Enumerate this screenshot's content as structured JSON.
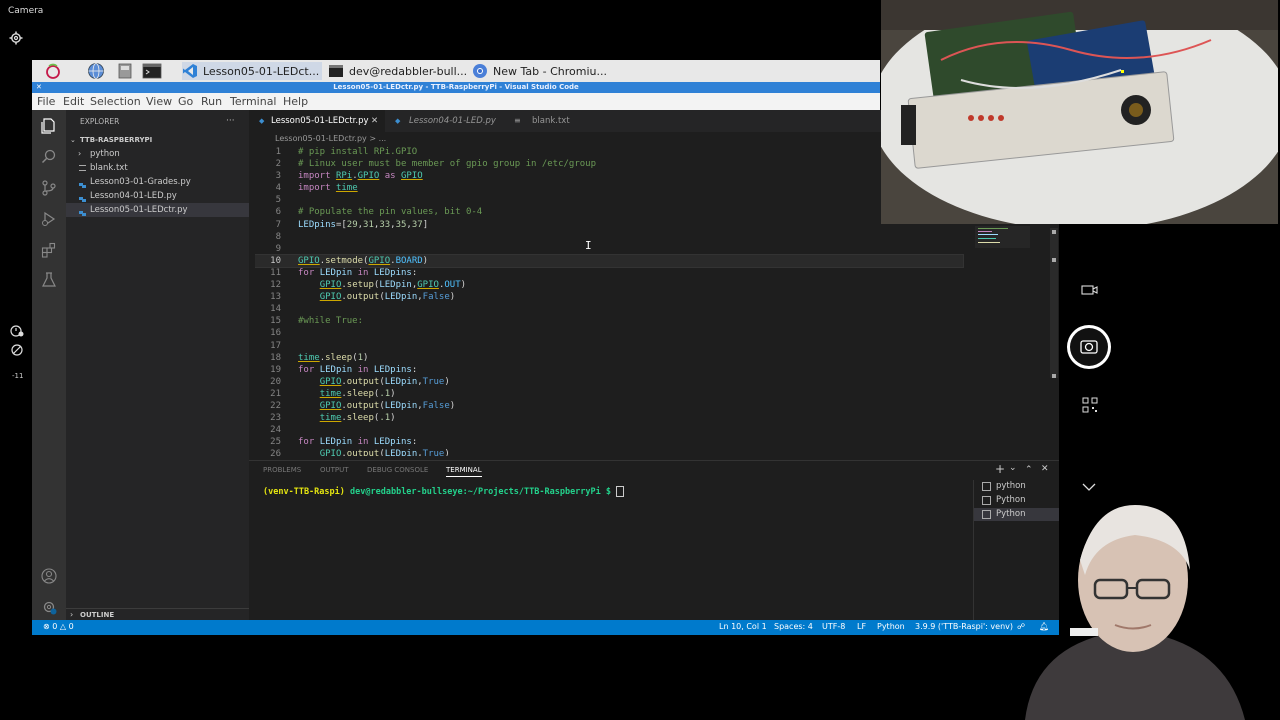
{
  "camera_app": {
    "title": "Camera",
    "left_icons": [
      "gear-icon",
      "timer-icon",
      "exposure-icon"
    ],
    "exposure_value": "-11"
  },
  "taskbar": {
    "tasks": [
      {
        "label": "Lesson05-01-LEDct...",
        "icon": "vscode-icon"
      },
      {
        "label": "dev@redabbler-bull...",
        "icon": "terminal-icon"
      },
      {
        "label": "New Tab - Chromiu...",
        "icon": "chromium-icon"
      }
    ]
  },
  "vscode": {
    "window_title": "Lesson05-01-LEDctr.py - TTB-RaspberryPi - Visual Studio Code",
    "menu": [
      "File",
      "Edit",
      "Selection",
      "View",
      "Go",
      "Run",
      "Terminal",
      "Help"
    ],
    "explorer": {
      "header": "EXPLORER",
      "more": "···",
      "root": "TTB-RASPBERRYPI",
      "items": [
        {
          "label": "python",
          "type": "folder"
        },
        {
          "label": "blank.txt",
          "type": "file"
        },
        {
          "label": "Lesson03-01-Grades.py",
          "type": "py"
        },
        {
          "label": "Lesson04-01-LED.py",
          "type": "py"
        },
        {
          "label": "Lesson05-01-LEDctr.py",
          "type": "py",
          "selected": true
        }
      ],
      "outline": "OUTLINE"
    },
    "tabs": [
      {
        "label": "Lesson05-01-LEDctr.py",
        "active": true,
        "close": "✕"
      },
      {
        "label": "Lesson04-01-LED.py",
        "active": false
      },
      {
        "label": "blank.txt",
        "active": false
      }
    ],
    "breadcrumb": "Lesson05-01-LEDctr.py > ...",
    "current_line": 10,
    "code": [
      {
        "n": "1",
        "tokens": [
          {
            "c": "cmt",
            "t": "# pip install RPi.GPIO"
          }
        ]
      },
      {
        "n": "2",
        "tokens": [
          {
            "c": "cmt",
            "t": "# Linux user must be member of gpio group in /etc/group"
          }
        ]
      },
      {
        "n": "3",
        "tokens": [
          {
            "c": "kw",
            "t": "import "
          },
          {
            "c": "mod",
            "t": "RPi"
          },
          {
            "c": "txt",
            "t": "."
          },
          {
            "c": "mod",
            "t": "GPIO"
          },
          {
            "c": "kw",
            "t": " as "
          },
          {
            "c": "mod",
            "t": "GPIO"
          }
        ]
      },
      {
        "n": "4",
        "tokens": [
          {
            "c": "kw",
            "t": "import "
          },
          {
            "c": "mod",
            "t": "time"
          }
        ]
      },
      {
        "n": "5",
        "tokens": []
      },
      {
        "n": "6",
        "tokens": [
          {
            "c": "cmt",
            "t": "# Populate the pin values, bit 0-4"
          }
        ]
      },
      {
        "n": "7",
        "tokens": [
          {
            "c": "var",
            "t": "LEDpins"
          },
          {
            "c": "txt",
            "t": "=["
          },
          {
            "c": "num",
            "t": "29"
          },
          {
            "c": "txt",
            "t": ","
          },
          {
            "c": "num",
            "t": "31"
          },
          {
            "c": "txt",
            "t": ","
          },
          {
            "c": "num",
            "t": "33"
          },
          {
            "c": "txt",
            "t": ","
          },
          {
            "c": "num",
            "t": "35"
          },
          {
            "c": "txt",
            "t": ","
          },
          {
            "c": "num",
            "t": "37"
          },
          {
            "c": "txt",
            "t": "]"
          }
        ]
      },
      {
        "n": "8",
        "tokens": []
      },
      {
        "n": "9",
        "tokens": []
      },
      {
        "n": "10",
        "tokens": [
          {
            "c": "mod",
            "t": "GPIO"
          },
          {
            "c": "txt",
            "t": "."
          },
          {
            "c": "fn",
            "t": "setmode"
          },
          {
            "c": "txt",
            "t": "("
          },
          {
            "c": "mod",
            "t": "GPIO"
          },
          {
            "c": "txt",
            "t": "."
          },
          {
            "c": "const",
            "t": "BOARD"
          },
          {
            "c": "txt",
            "t": ")"
          }
        ]
      },
      {
        "n": "11",
        "tokens": [
          {
            "c": "kw",
            "t": "for "
          },
          {
            "c": "var",
            "t": "LEDpin"
          },
          {
            "c": "kw",
            "t": " in "
          },
          {
            "c": "var",
            "t": "LEDpins"
          },
          {
            "c": "txt",
            "t": ":"
          }
        ]
      },
      {
        "n": "12",
        "tokens": [
          {
            "c": "txt",
            "t": "    "
          },
          {
            "c": "mod",
            "t": "GPIO"
          },
          {
            "c": "txt",
            "t": "."
          },
          {
            "c": "fn",
            "t": "setup"
          },
          {
            "c": "txt",
            "t": "("
          },
          {
            "c": "var",
            "t": "LEDpin"
          },
          {
            "c": "txt",
            "t": ","
          },
          {
            "c": "mod",
            "t": "GPIO"
          },
          {
            "c": "txt",
            "t": "."
          },
          {
            "c": "const",
            "t": "OUT"
          },
          {
            "c": "txt",
            "t": ")"
          }
        ]
      },
      {
        "n": "13",
        "tokens": [
          {
            "c": "txt",
            "t": "    "
          },
          {
            "c": "mod",
            "t": "GPIO"
          },
          {
            "c": "txt",
            "t": "."
          },
          {
            "c": "fn",
            "t": "output"
          },
          {
            "c": "txt",
            "t": "("
          },
          {
            "c": "var",
            "t": "LEDpin"
          },
          {
            "c": "txt",
            "t": ","
          },
          {
            "c": "bool",
            "t": "False"
          },
          {
            "c": "txt",
            "t": ")"
          }
        ]
      },
      {
        "n": "14",
        "tokens": []
      },
      {
        "n": "15",
        "tokens": [
          {
            "c": "cmt",
            "t": "#while True:"
          }
        ]
      },
      {
        "n": "16",
        "tokens": []
      },
      {
        "n": "17",
        "tokens": []
      },
      {
        "n": "18",
        "tokens": [
          {
            "c": "mod",
            "t": "time"
          },
          {
            "c": "txt",
            "t": "."
          },
          {
            "c": "fn",
            "t": "sleep"
          },
          {
            "c": "txt",
            "t": "("
          },
          {
            "c": "num",
            "t": "1"
          },
          {
            "c": "txt",
            "t": ")"
          }
        ]
      },
      {
        "n": "19",
        "tokens": [
          {
            "c": "kw",
            "t": "for "
          },
          {
            "c": "var",
            "t": "LEDpin"
          },
          {
            "c": "kw",
            "t": " in "
          },
          {
            "c": "var",
            "t": "LEDpins"
          },
          {
            "c": "txt",
            "t": ":"
          }
        ]
      },
      {
        "n": "20",
        "tokens": [
          {
            "c": "txt",
            "t": "    "
          },
          {
            "c": "mod",
            "t": "GPIO"
          },
          {
            "c": "txt",
            "t": "."
          },
          {
            "c": "fn",
            "t": "output"
          },
          {
            "c": "txt",
            "t": "("
          },
          {
            "c": "var",
            "t": "LEDpin"
          },
          {
            "c": "txt",
            "t": ","
          },
          {
            "c": "bool",
            "t": "True"
          },
          {
            "c": "txt",
            "t": ")"
          }
        ]
      },
      {
        "n": "21",
        "tokens": [
          {
            "c": "txt",
            "t": "    "
          },
          {
            "c": "mod",
            "t": "time"
          },
          {
            "c": "txt",
            "t": "."
          },
          {
            "c": "fn",
            "t": "sleep"
          },
          {
            "c": "txt",
            "t": "("
          },
          {
            "c": "num",
            "t": ".1"
          },
          {
            "c": "txt",
            "t": ")"
          }
        ]
      },
      {
        "n": "22",
        "tokens": [
          {
            "c": "txt",
            "t": "    "
          },
          {
            "c": "mod",
            "t": "GPIO"
          },
          {
            "c": "txt",
            "t": "."
          },
          {
            "c": "fn",
            "t": "output"
          },
          {
            "c": "txt",
            "t": "("
          },
          {
            "c": "var",
            "t": "LEDpin"
          },
          {
            "c": "txt",
            "t": ","
          },
          {
            "c": "bool",
            "t": "False"
          },
          {
            "c": "txt",
            "t": ")"
          }
        ]
      },
      {
        "n": "23",
        "tokens": [
          {
            "c": "txt",
            "t": "    "
          },
          {
            "c": "mod",
            "t": "time"
          },
          {
            "c": "txt",
            "t": "."
          },
          {
            "c": "fn",
            "t": "sleep"
          },
          {
            "c": "txt",
            "t": "("
          },
          {
            "c": "num",
            "t": ".1"
          },
          {
            "c": "txt",
            "t": ")"
          }
        ]
      },
      {
        "n": "24",
        "tokens": []
      },
      {
        "n": "25",
        "tokens": [
          {
            "c": "kw",
            "t": "for "
          },
          {
            "c": "var",
            "t": "LEDpin"
          },
          {
            "c": "kw",
            "t": " in "
          },
          {
            "c": "var",
            "t": "LEDpins"
          },
          {
            "c": "txt",
            "t": ":"
          }
        ]
      },
      {
        "n": "26",
        "tokens": [
          {
            "c": "txt",
            "t": "    "
          },
          {
            "c": "mod",
            "t": "GPIO"
          },
          {
            "c": "txt",
            "t": "."
          },
          {
            "c": "fn",
            "t": "output"
          },
          {
            "c": "txt",
            "t": "("
          },
          {
            "c": "var",
            "t": "LEDpin"
          },
          {
            "c": "txt",
            "t": ","
          },
          {
            "c": "bool",
            "t": "True"
          },
          {
            "c": "txt",
            "t": ")"
          }
        ]
      }
    ],
    "panel": {
      "tabs": [
        "PROBLEMS",
        "OUTPUT",
        "DEBUG CONSOLE",
        "TERMINAL"
      ],
      "active_tab": "TERMINAL",
      "actions": [
        "+",
        "⌄",
        "⌃",
        "✕"
      ],
      "prompt_env": "(venv-TTB-Raspi)",
      "prompt_user": "dev@redabbler-bullseye:~/Projects/TTB-RaspberryPi $",
      "terminals": [
        {
          "label": "python",
          "selected": false
        },
        {
          "label": "Python",
          "selected": false
        },
        {
          "label": "Python",
          "selected": true
        }
      ]
    },
    "status": {
      "errors": "0",
      "warnings": "0",
      "cursor": "Ln 10, Col 1",
      "spaces": "Spaces: 4",
      "encoding": "UTF-8",
      "eol": "LF",
      "language": "Python",
      "interpreter": "3.9.9 ('TTB-Raspi': venv)"
    }
  },
  "colors": {
    "accent": "#007acc",
    "titlebar": "#2f81d6",
    "editor_bg": "#1e1e1e",
    "sidebar_bg": "#252526",
    "activity_bg": "#333333"
  }
}
